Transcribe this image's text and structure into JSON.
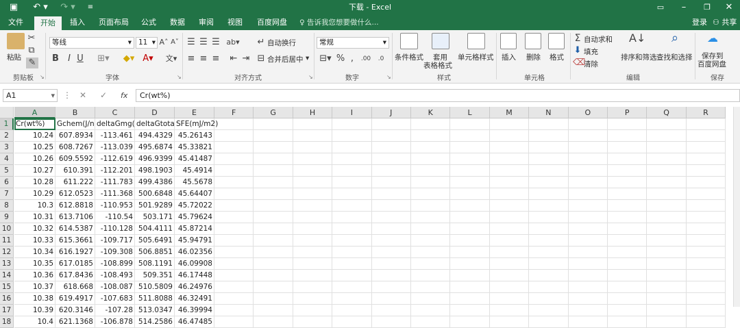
{
  "window": {
    "title": "下载 - Excel",
    "save_icon": "save-icon",
    "undo_icon": "undo-icon",
    "redo_icon": "redo-icon"
  },
  "tabs": [
    "文件",
    "开始",
    "插入",
    "页面布局",
    "公式",
    "数据",
    "审阅",
    "视图",
    "百度网盘"
  ],
  "active_tab": "开始",
  "tell_me": "告诉我您想要做什么...",
  "account": {
    "login": "登录",
    "share": "共享"
  },
  "ribbon": {
    "clipboard": {
      "paste": "粘贴",
      "label": "剪贴板"
    },
    "font": {
      "name": "等线",
      "size": "11",
      "bold": "B",
      "italic": "I",
      "underline": "U",
      "label": "字体"
    },
    "alignment": {
      "wrap": "自动换行",
      "merge": "合并后居中",
      "label": "对齐方式"
    },
    "number": {
      "format": "常规",
      "label": "数字"
    },
    "styles": {
      "conditional": "条件格式",
      "table_line1": "套用",
      "table_line2": "表格格式",
      "cell_styles": "单元格样式",
      "label": "样式"
    },
    "cells": {
      "insert": "插入",
      "delete": "删除",
      "format": "格式",
      "label": "单元格"
    },
    "editing": {
      "autosum": "自动求和",
      "fill": "填充",
      "clear": "清除",
      "sort": "排序和筛选",
      "find": "查找和选择",
      "label": "编辑"
    },
    "save": {
      "line1": "保存到",
      "line2": "百度网盘",
      "label": "保存"
    }
  },
  "formula_bar": {
    "name_box": "A1",
    "fx": "fx",
    "content": "Cr(wt%)"
  },
  "columns": [
    "A",
    "B",
    "C",
    "D",
    "E",
    "F",
    "G",
    "H",
    "I",
    "J",
    "K",
    "L",
    "M",
    "N",
    "O",
    "P",
    "Q",
    "R"
  ],
  "rows": [
    [
      "Cr(wt%)",
      "Gchem(J/n",
      "deltaGmg(",
      "deltaGtota",
      "SFE(mJ/m2)"
    ],
    [
      "10.24",
      "607.8934",
      "-113.461",
      "494.4329",
      "45.26143"
    ],
    [
      "10.25",
      "608.7267",
      "-113.039",
      "495.6874",
      "45.33821"
    ],
    [
      "10.26",
      "609.5592",
      "-112.619",
      "496.9399",
      "45.41487"
    ],
    [
      "10.27",
      "610.391",
      "-112.201",
      "498.1903",
      "45.4914"
    ],
    [
      "10.28",
      "611.222",
      "-111.783",
      "499.4386",
      "45.5678"
    ],
    [
      "10.29",
      "612.0523",
      "-111.368",
      "500.6848",
      "45.64407"
    ],
    [
      "10.3",
      "612.8818",
      "-110.953",
      "501.9289",
      "45.72022"
    ],
    [
      "10.31",
      "613.7106",
      "-110.54",
      "503.171",
      "45.79624"
    ],
    [
      "10.32",
      "614.5387",
      "-110.128",
      "504.4111",
      "45.87214"
    ],
    [
      "10.33",
      "615.3661",
      "-109.717",
      "505.6491",
      "45.94791"
    ],
    [
      "10.34",
      "616.1927",
      "-109.308",
      "506.8851",
      "46.02356"
    ],
    [
      "10.35",
      "617.0185",
      "-108.899",
      "508.1191",
      "46.09908"
    ],
    [
      "10.36",
      "617.8436",
      "-108.493",
      "509.351",
      "46.17448"
    ],
    [
      "10.37",
      "618.668",
      "-108.087",
      "510.5809",
      "46.24976"
    ],
    [
      "10.38",
      "619.4917",
      "-107.683",
      "511.8088",
      "46.32491"
    ],
    [
      "10.39",
      "620.3146",
      "-107.28",
      "513.0347",
      "46.39994"
    ],
    [
      "10.4",
      "621.1368",
      "-106.878",
      "514.2586",
      "46.47485"
    ]
  ],
  "accent_color": "#217346"
}
